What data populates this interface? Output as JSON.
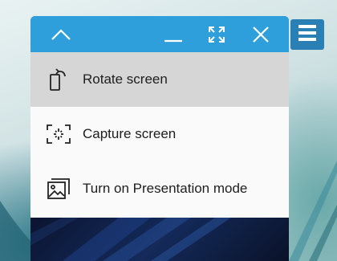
{
  "titlebar": {
    "collapse_icon": "chevron-up-icon",
    "minimize_icon": "minimize-icon",
    "fullscreen_icon": "expand-icon",
    "close_icon": "close-icon"
  },
  "menu": {
    "items": [
      {
        "label": "Rotate screen",
        "icon": "rotate-screen-icon",
        "selected": true
      },
      {
        "label": "Capture screen",
        "icon": "capture-screen-icon",
        "selected": false
      },
      {
        "label": "Turn on Presentation mode",
        "icon": "presentation-icon",
        "selected": false
      }
    ]
  },
  "side_button": {
    "icon": "menu-list-icon"
  },
  "colors": {
    "titlebar": "#2e9fdb",
    "side_button": "#2a7fb4",
    "menu_bg": "#fafafa",
    "selected_bg": "#d6d6d6"
  }
}
